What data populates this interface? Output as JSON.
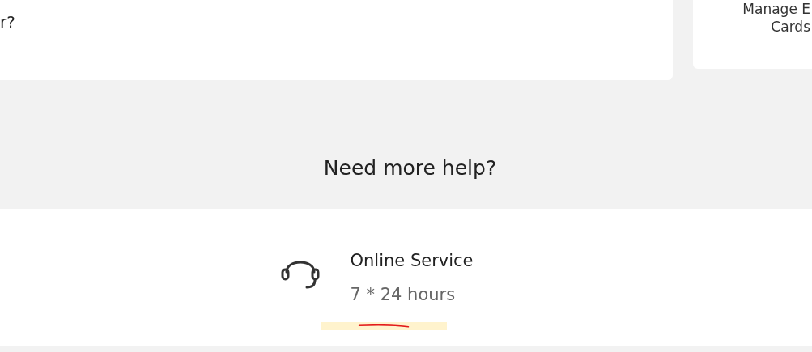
{
  "question_card": {
    "text": "r?"
  },
  "side_card": {
    "lines": [
      "Manage E",
      "Cards"
    ]
  },
  "help_section": {
    "title": "Need more help?"
  },
  "contact": {
    "title": "Online Service",
    "hours": "7 * 24 hours"
  }
}
